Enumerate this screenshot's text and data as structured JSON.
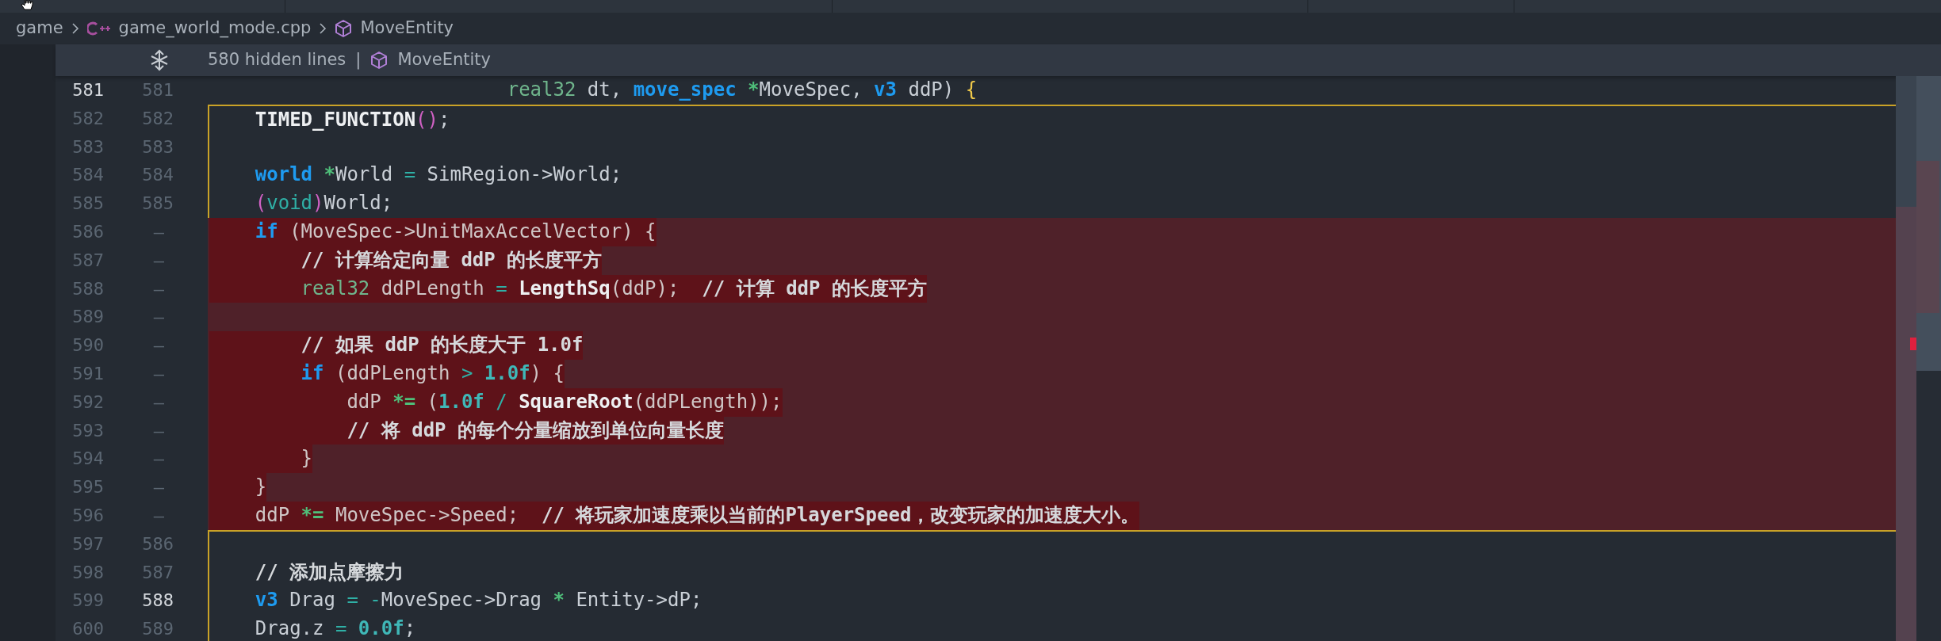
{
  "breadcrumb": [
    {
      "kind": "folder",
      "label": "game"
    },
    {
      "kind": "file",
      "label": "game_world_mode.cpp"
    },
    {
      "kind": "symbol",
      "label": "MoveEntity"
    }
  ],
  "hidden_region": {
    "text": "580 hidden lines",
    "separator": "|",
    "symbol": "MoveEntity"
  },
  "lines": [
    {
      "old": "581",
      "new": "581",
      "old_current": true,
      "new_current": false,
      "removed": false,
      "scope_guide": false,
      "tokens": [
        {
          "kind": "type",
          "text": "                          real32"
        },
        {
          "kind": "plain",
          "text": " dt, "
        },
        {
          "kind": "kw",
          "text": "move_spec"
        },
        {
          "kind": "star",
          "text": " *"
        },
        {
          "kind": "plain",
          "text": "MoveSpec, "
        },
        {
          "kind": "kw",
          "text": "v3"
        },
        {
          "kind": "plain",
          "text": " ddP) "
        },
        {
          "kind": "bracket",
          "text": "{"
        }
      ]
    },
    {
      "old": "582",
      "new": "582",
      "old_current": false,
      "new_current": false,
      "removed": false,
      "scope_guide": true,
      "tokens": [
        {
          "kind": "fn",
          "text": "    TIMED_FUNCTION"
        },
        {
          "kind": "paren",
          "text": "()"
        },
        {
          "kind": "plain",
          "text": ";"
        }
      ]
    },
    {
      "old": "583",
      "new": "583",
      "old_current": false,
      "new_current": false,
      "removed": false,
      "scope_guide": true
    },
    {
      "old": "584",
      "new": "584",
      "old_current": false,
      "new_current": false,
      "removed": false,
      "scope_guide": true,
      "tokens": [
        {
          "kind": "kw",
          "text": "    world"
        },
        {
          "kind": "star",
          "text": " *"
        },
        {
          "kind": "plain",
          "text": "World "
        },
        {
          "kind": "op",
          "text": "="
        },
        {
          "kind": "plain",
          "text": " SimRegion->World;"
        }
      ]
    },
    {
      "old": "585",
      "new": "585",
      "old_current": false,
      "new_current": false,
      "removed": false,
      "scope_guide": true,
      "tokens": [
        {
          "kind": "paren",
          "text": "    ("
        },
        {
          "kind": "op",
          "text": "void"
        },
        {
          "kind": "paren",
          "text": ")"
        },
        {
          "kind": "plain",
          "text": "World;"
        }
      ]
    },
    {
      "old": "586",
      "new": "—",
      "old_current": false,
      "new_current": false,
      "removed": true,
      "scope_guide": false,
      "tokens": [
        {
          "kind": "kw",
          "text": "    if"
        },
        {
          "kind": "plain",
          "text": " (MoveSpec->UnitMaxAccelVector) {"
        }
      ]
    },
    {
      "old": "587",
      "new": "—",
      "old_current": false,
      "new_current": false,
      "removed": true,
      "scope_guide": false,
      "tokens": [
        {
          "kind": "comment",
          "text": "        // 计算给定向量 ddP 的长度平方"
        }
      ]
    },
    {
      "old": "588",
      "new": "—",
      "old_current": false,
      "new_current": false,
      "removed": true,
      "scope_guide": false,
      "tokens": [
        {
          "kind": "type",
          "text": "        real32"
        },
        {
          "kind": "plain",
          "text": " ddPLength "
        },
        {
          "kind": "op",
          "text": "="
        },
        {
          "kind": "fn",
          "text": " LengthSq"
        },
        {
          "kind": "plain",
          "text": "(ddP);  "
        },
        {
          "kind": "comment",
          "text": "// 计算 ddP 的长度平方"
        }
      ]
    },
    {
      "old": "589",
      "new": "—",
      "old_current": false,
      "new_current": false,
      "removed": true,
      "scope_guide": false
    },
    {
      "old": "590",
      "new": "—",
      "old_current": false,
      "new_current": false,
      "removed": true,
      "scope_guide": false,
      "tokens": [
        {
          "kind": "comment",
          "text": "        // 如果 ddP 的长度大于 1.0f"
        }
      ]
    },
    {
      "old": "591",
      "new": "—",
      "old_current": false,
      "new_current": false,
      "removed": true,
      "scope_guide": false,
      "tokens": [
        {
          "kind": "kw",
          "text": "        if"
        },
        {
          "kind": "plain",
          "text": " (ddPLength "
        },
        {
          "kind": "op",
          "text": ">"
        },
        {
          "kind": "num",
          "text": " 1.0f"
        },
        {
          "kind": "plain",
          "text": ") {"
        }
      ]
    },
    {
      "old": "592",
      "new": "—",
      "old_current": false,
      "new_current": false,
      "removed": true,
      "scope_guide": false,
      "tokens": [
        {
          "kind": "plain",
          "text": "            ddP "
        },
        {
          "kind": "star",
          "text": "*="
        },
        {
          "kind": "plain",
          "text": " ("
        },
        {
          "kind": "num",
          "text": "1.0f"
        },
        {
          "kind": "op",
          "text": " /"
        },
        {
          "kind": "fn",
          "text": " SquareRoot"
        },
        {
          "kind": "plain",
          "text": "(ddPLength));"
        }
      ]
    },
    {
      "old": "593",
      "new": "—",
      "old_current": false,
      "new_current": false,
      "removed": true,
      "scope_guide": false,
      "tokens": [
        {
          "kind": "comment",
          "text": "            // 将 ddP 的每个分量缩放到单位向量长度"
        }
      ]
    },
    {
      "old": "594",
      "new": "—",
      "old_current": false,
      "new_current": false,
      "removed": true,
      "scope_guide": false,
      "tokens": [
        {
          "kind": "plain",
          "text": "        }"
        }
      ]
    },
    {
      "old": "595",
      "new": "—",
      "old_current": false,
      "new_current": false,
      "removed": true,
      "scope_guide": false,
      "tokens": [
        {
          "kind": "plain",
          "text": "    }"
        }
      ]
    },
    {
      "old": "596",
      "new": "—",
      "old_current": false,
      "new_current": false,
      "removed": true,
      "scope_guide": false,
      "tokens": [
        {
          "kind": "plain",
          "text": "    ddP "
        },
        {
          "kind": "star",
          "text": "*="
        },
        {
          "kind": "plain",
          "text": " MoveSpec->Speed;  "
        },
        {
          "kind": "comment",
          "text": "// 将玩家加速度乘以当前的PlayerSpeed，改变玩家的加速度大小。"
        }
      ]
    },
    {
      "old": "597",
      "new": "586",
      "old_current": false,
      "new_current": false,
      "removed": false,
      "scope_guide": true
    },
    {
      "old": "598",
      "new": "587",
      "old_current": false,
      "new_current": false,
      "removed": false,
      "scope_guide": true,
      "tokens": [
        {
          "kind": "comment",
          "text": "    // 添加点摩擦力"
        }
      ]
    },
    {
      "old": "599",
      "new": "588",
      "old_current": false,
      "new_current": true,
      "removed": false,
      "scope_guide": true,
      "tokens": [
        {
          "kind": "kw",
          "text": "    v3"
        },
        {
          "kind": "plain",
          "text": " Drag "
        },
        {
          "kind": "op",
          "text": "= -"
        },
        {
          "kind": "plain",
          "text": "MoveSpec->Drag "
        },
        {
          "kind": "star",
          "text": "*"
        },
        {
          "kind": "plain",
          "text": " Entity->dP;"
        }
      ]
    },
    {
      "old": "600",
      "new": "589",
      "old_current": false,
      "new_current": false,
      "removed": false,
      "scope_guide": true,
      "tokens": [
        {
          "kind": "plain",
          "text": "    Drag.z "
        },
        {
          "kind": "op",
          "text": "="
        },
        {
          "kind": "num",
          "text": " 0.0f"
        },
        {
          "kind": "plain",
          "text": ";"
        }
      ]
    }
  ]
}
